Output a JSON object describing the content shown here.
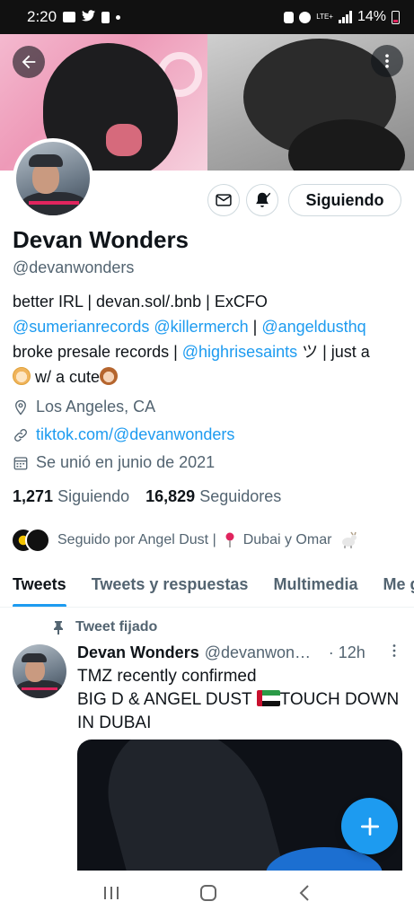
{
  "status_bar": {
    "time": "2:20",
    "network": "LTE+",
    "battery": "14%"
  },
  "profile": {
    "name": "Devan Wonders",
    "handle": "@devanwonders",
    "follow_button": "Siguiendo",
    "bio": {
      "line1": "better IRL | devan.sol/.bnb | ExCFO",
      "line2_link1": "@sumerianrecords",
      "line2_link2": "@killermerch",
      "line2_sep": " | ",
      "line2_link3": "@angeldusthq",
      "line3_prefix": "broke presale records | ",
      "line3_link": "@highrisesaints",
      "line3_suffix": " ツ | just a",
      "line4": " w/ a cute"
    },
    "location": "Los Angeles, CA",
    "website": "tiktok.com/@devanwonders",
    "joined": "Se unió en junio de 2021",
    "following_count": "1,271",
    "following_label": "Siguiendo",
    "followers_count": "16,829",
    "followers_label": "Seguidores",
    "followed_by_prefix": "Seguido por Angel Dust | ",
    "followed_by_suffix": " Dubai y Omar"
  },
  "tabs": [
    {
      "label": "Tweets"
    },
    {
      "label": "Tweets y respuestas"
    },
    {
      "label": "Multimedia"
    },
    {
      "label": "Me gusta"
    }
  ],
  "tweet": {
    "pinned_label": "Tweet fijado",
    "name": "Devan Wonders",
    "handle": "@devanwonders",
    "time": "· 12h",
    "line1": "TMZ recently confirmed",
    "line2_prefix": "BIG D & ANGEL DUST ",
    "line2_suffix": "TOUCH DOWN",
    "line3": "IN DUBAI"
  },
  "colors": {
    "accent": "#1d9bf0",
    "text_primary": "#0f1419",
    "text_secondary": "#536471"
  },
  "icons": [
    "back-arrow-icon",
    "more-vertical-icon",
    "mail-icon",
    "bell-icon",
    "location-icon",
    "link-icon",
    "calendar-icon",
    "pin-icon",
    "compose-plus-icon",
    "recent-apps-icon",
    "home-icon",
    "back-icon"
  ]
}
